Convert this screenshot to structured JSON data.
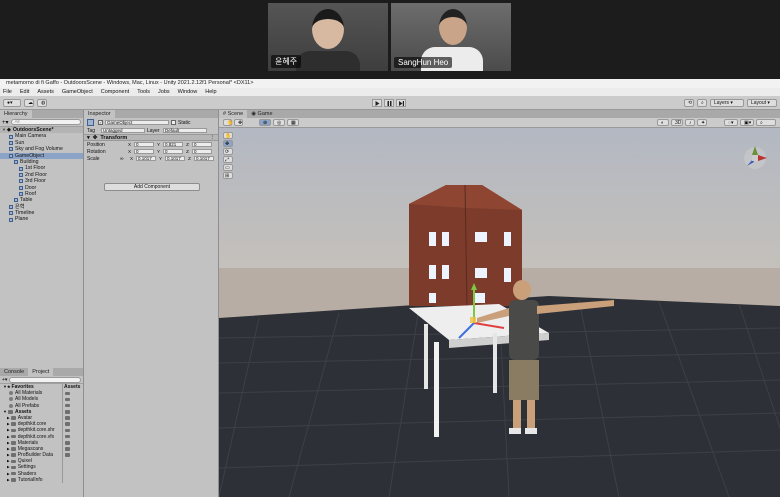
{
  "video": {
    "participant_left": "윤혜주",
    "participant_right": "SangHun Heo"
  },
  "window": {
    "title": "metamorno di fi Gaffo - OutdoorsScene - Windows, Mac, Linux - Unity 2021.2.12f1 Personal* <DX11>"
  },
  "menu": [
    "File",
    "Edit",
    "Assets",
    "GameObject",
    "Component",
    "Tools",
    "Jobs",
    "Window",
    "Help"
  ],
  "toolbar": {
    "layers_label": "Layers",
    "layout_label": "Layout"
  },
  "hierarchy": {
    "tab_label": "Hierarchy",
    "search_placeholder": "All",
    "scene_name": "OutdoorsScene*",
    "items": [
      {
        "label": "Main Camera",
        "depth": 1
      },
      {
        "label": "Sun",
        "depth": 1
      },
      {
        "label": "Sky and Fog Volume",
        "depth": 1
      },
      {
        "label": "GameObject",
        "depth": 1
      },
      {
        "label": "Building",
        "depth": 2
      },
      {
        "label": "1st Floor",
        "depth": 3
      },
      {
        "label": "2nd Floor",
        "depth": 3
      },
      {
        "label": "3rd Floor",
        "depth": 3
      },
      {
        "label": "Door",
        "depth": 3
      },
      {
        "label": "Roof",
        "depth": 3
      },
      {
        "label": "Table",
        "depth": 2
      },
      {
        "label": "은혁",
        "depth": 1
      },
      {
        "label": "Timeline",
        "depth": 1
      },
      {
        "label": "Plane",
        "depth": 1
      }
    ]
  },
  "inspector": {
    "tab_label": "Inspector",
    "object_name": "GameObject",
    "static_label": "Static",
    "tag_label": "Tag",
    "tag_value": "Untagged",
    "layer_label": "Layer",
    "layer_value": "Default",
    "transform_label": "Transform",
    "position_label": "Position",
    "rotation_label": "Rotation",
    "scale_label": "Scale",
    "position": {
      "x": "0",
      "y": "0.821",
      "z": "0"
    },
    "rotation": {
      "x": "0",
      "y": "0",
      "z": "0"
    },
    "scale": {
      "x": "0.1017",
      "y": "0.1017",
      "z": "0.1017"
    },
    "add_component_label": "Add Component"
  },
  "project": {
    "console_tab": "Console",
    "project_tab": "Project",
    "favorites_label": "Favorites",
    "favorites": [
      "All Materials",
      "All Models",
      "All Prefabs"
    ],
    "assets_label": "Assets",
    "assets_header": "Assets",
    "folders": [
      "Avatar",
      "depthkit.core",
      "depthkit.core.shr",
      "depthkit.core.vfx",
      "Materials",
      "Megascans",
      "ProBuilder Data",
      "Quixel",
      "Settings",
      "Shaders",
      "TutorialInfo"
    ]
  },
  "scene": {
    "scene_tab": "Scene",
    "game_tab": "Game",
    "mode_3d": "3D"
  }
}
